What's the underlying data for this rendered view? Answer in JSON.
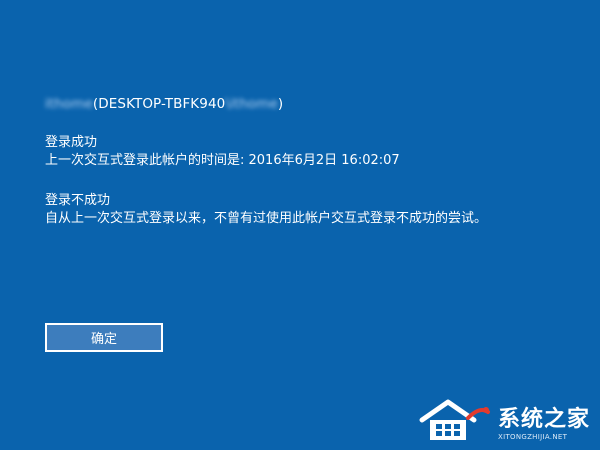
{
  "account": {
    "name_blurred": "ithome",
    "machine_prefix": " (DESKTOP-TBFK940",
    "sep": "\\",
    "user_blurred": "ithome",
    "suffix": ")"
  },
  "success_section": {
    "heading": "登录成功",
    "detail": "上一次交互式登录此帐户的时间是: 2016年6月2日 16:02:07"
  },
  "failure_section": {
    "heading": "登录不成功",
    "detail": "自从上一次交互式登录以来，不曾有过使用此帐户交互式登录不成功的尝试。"
  },
  "buttons": {
    "ok_label": "确定"
  },
  "watermark": {
    "title": "系统之家",
    "subtitle": "XITONGZHIJIA.NET",
    "icon": "house-logo-icon"
  },
  "colors": {
    "background": "#0a63ad",
    "button_fill": "#3d7dbd",
    "text": "#ffffff"
  }
}
